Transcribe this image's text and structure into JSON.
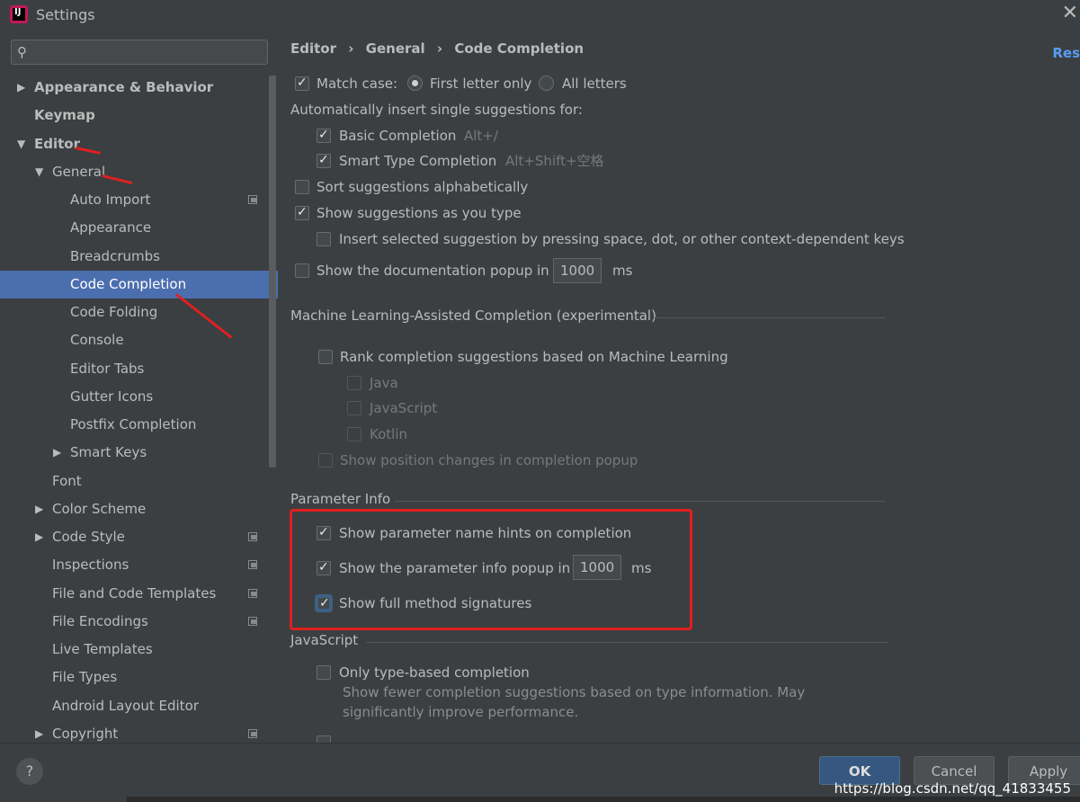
{
  "window": {
    "title": "Settings",
    "close_glyph": "✕"
  },
  "sidebar": {
    "search_placeholder": "",
    "items": [
      {
        "label": "Appearance & Behavior"
      },
      {
        "label": "Keymap"
      },
      {
        "label": "Editor"
      },
      {
        "label": "General"
      },
      {
        "label": "Auto Import"
      },
      {
        "label": "Appearance"
      },
      {
        "label": "Breadcrumbs"
      },
      {
        "label": "Code Completion"
      },
      {
        "label": "Code Folding"
      },
      {
        "label": "Console"
      },
      {
        "label": "Editor Tabs"
      },
      {
        "label": "Gutter Icons"
      },
      {
        "label": "Postfix Completion"
      },
      {
        "label": "Smart Keys"
      },
      {
        "label": "Font"
      },
      {
        "label": "Color Scheme"
      },
      {
        "label": "Code Style"
      },
      {
        "label": "Inspections"
      },
      {
        "label": "File and Code Templates"
      },
      {
        "label": "File Encodings"
      },
      {
        "label": "Live Templates"
      },
      {
        "label": "File Types"
      },
      {
        "label": "Android Layout Editor"
      },
      {
        "label": "Copyright"
      }
    ]
  },
  "breadcrumb": {
    "parts": [
      "Editor",
      "General",
      "Code Completion"
    ],
    "sep": "›",
    "reset_label": "Res"
  },
  "options": {
    "match_case": "Match case:",
    "first_letter_only": "First letter only",
    "all_letters": "All letters",
    "auto_insert_header": "Automatically insert single suggestions for:",
    "basic_completion": "Basic Completion",
    "basic_completion_shortcut": "Alt+/",
    "smart_type_completion": "Smart Type Completion",
    "smart_type_shortcut": "Alt+Shift+空格",
    "sort_alpha": "Sort suggestions alphabetically",
    "show_as_you_type": "Show suggestions as you type",
    "insert_selected": "Insert selected suggestion by pressing space, dot, or other context-dependent keys",
    "doc_popup": "Show the documentation popup in",
    "doc_popup_value": "1000",
    "ms": "ms"
  },
  "ml_section": {
    "title": "Machine Learning-Assisted Completion (experimental)",
    "rank": "Rank completion suggestions based on Machine Learning",
    "java": "Java",
    "javascript": "JavaScript",
    "kotlin": "Kotlin",
    "position_changes": "Show position changes in completion popup"
  },
  "param_section": {
    "title": "Parameter Info",
    "name_hints": "Show parameter name hints on completion",
    "info_popup": "Show the parameter info popup in",
    "info_popup_value": "1000",
    "ms": "ms",
    "full_signatures": "Show full method signatures"
  },
  "js_section": {
    "title": "JavaScript",
    "type_based": "Only type-based completion",
    "desc_line1": "Show fewer completion suggestions based on type information. May",
    "desc_line2": "significantly improve performance."
  },
  "footer": {
    "help": "?",
    "ok": "OK",
    "cancel": "Cancel",
    "apply": "Apply",
    "watermark": "https://blog.csdn.net/qq_41833455"
  },
  "colors": {
    "background": "#3c3f41",
    "selection": "#4b6eaf",
    "annotation_red": "#e02020",
    "ok_button": "#365880",
    "link_blue": "#589df6"
  }
}
